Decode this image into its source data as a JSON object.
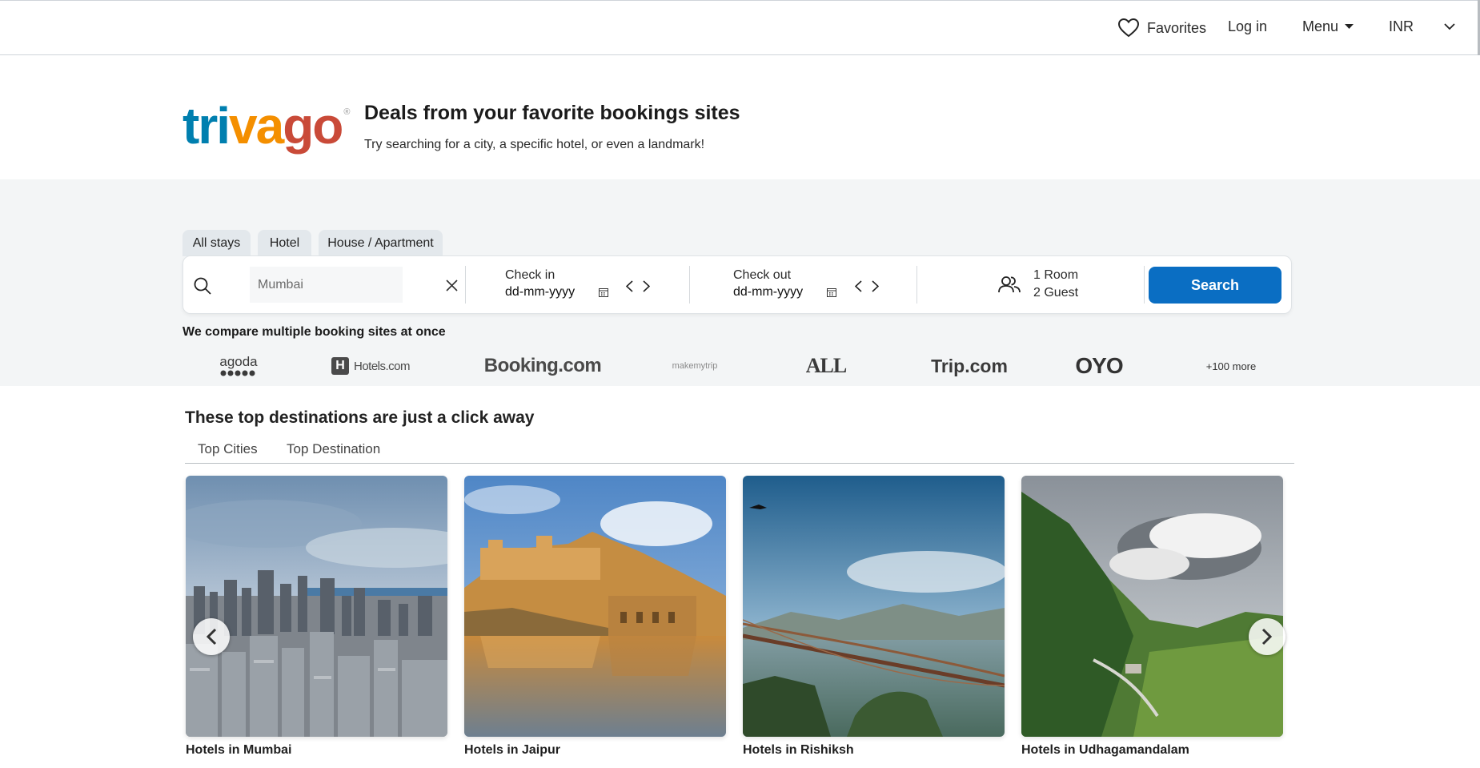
{
  "nav": {
    "favorites": "Favorites",
    "login": "Log in",
    "menu": "Menu",
    "currency": "INR"
  },
  "hero": {
    "logo": {
      "part1": "tri",
      "part2": "va",
      "part3": "go",
      "mark": "®"
    },
    "title": "Deals from your favorite bookings sites",
    "subtitle": "Try searching for a city, a specific hotel, or even a landmark!"
  },
  "tabs": [
    "All stays",
    "Hotel",
    "House / Apartment"
  ],
  "search": {
    "placeholder": "Mumbai",
    "checkin_label": "Check in",
    "checkin_value": "dd-mm-yyyy",
    "checkout_label": "Check out",
    "checkout_value": "dd-mm-yyyy",
    "rooms": "1 Room",
    "guests": "2 Guest",
    "button": "Search"
  },
  "compare": {
    "title": "We compare multiple booking sites at once",
    "partners": [
      "agoda",
      "Hotels.com",
      "Booking.com",
      "makemytrip",
      "ALL",
      "Trip.com",
      "OYO"
    ],
    "more": "+100 more"
  },
  "destinations": {
    "title": "These top destinations are just a click away",
    "tabs": [
      "Top Cities",
      "Top Destination"
    ],
    "cards": [
      {
        "label": "Hotels in Mumbai"
      },
      {
        "label": "Hotels in Jaipur"
      },
      {
        "label": "Hotels in Rishiksh"
      },
      {
        "label": "Hotels in Udhagamandalam"
      }
    ]
  },
  "colors": {
    "brand_blue": "#007faf",
    "brand_orange": "#f48f00",
    "brand_red": "#c94a38",
    "search_button": "#0a6ec3"
  },
  "icons": [
    "heart-icon",
    "caret-down-icon",
    "chevron-down-icon",
    "search-icon",
    "close-icon",
    "calendar-icon",
    "chevron-left-icon",
    "chevron-right-icon",
    "guests-icon"
  ]
}
